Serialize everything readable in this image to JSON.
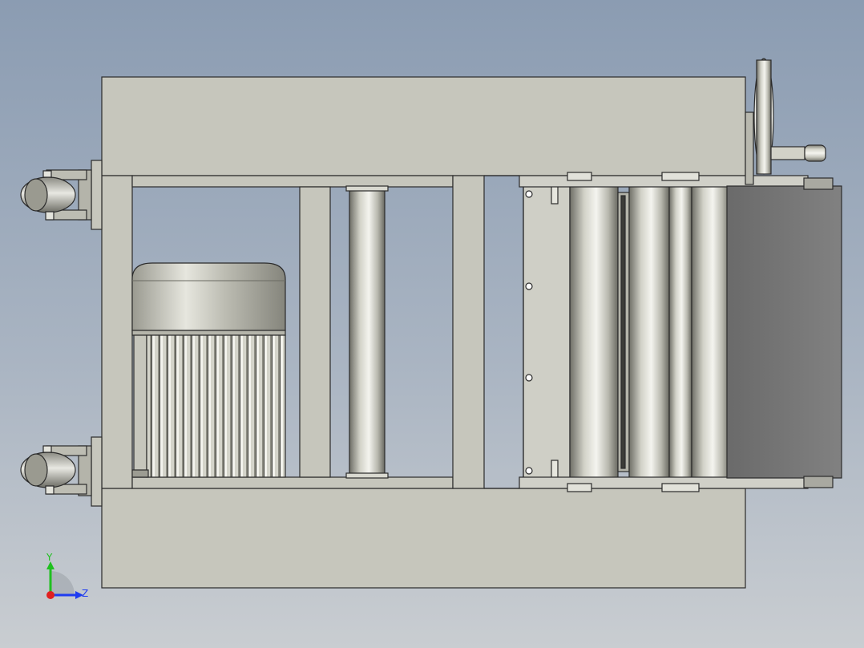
{
  "scene": {
    "view": "side elevation",
    "colors": {
      "background_top": "#8b9cb2",
      "background_bottom": "#c9cdd1",
      "frame": "#c6c6bc",
      "outline": "#2b2b2b",
      "metal_light": "#f2f2ee",
      "metal_dark": "#8a8a80",
      "cover": "#7a7a7a"
    }
  },
  "triad": {
    "y_label": "Y",
    "z_label": "Z",
    "y_color": "#1fc01f",
    "z_color": "#1f3cf0",
    "x_color": "#e02020"
  }
}
